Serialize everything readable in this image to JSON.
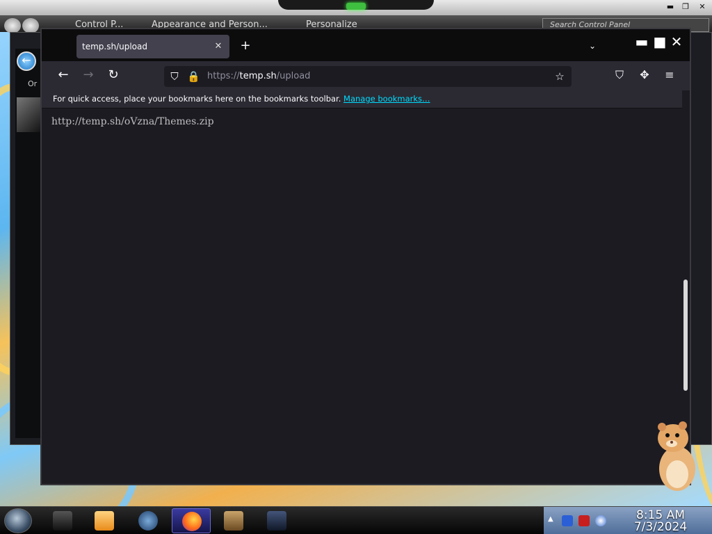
{
  "control_panel": {
    "crumbs": [
      "Control P...",
      "Appearance and Person...",
      "Personalize"
    ],
    "search_placeholder": "Search Control Panel",
    "side_label": "Or"
  },
  "browser": {
    "tab": {
      "title": "temp.sh/upload",
      "close_glyph": "✕"
    },
    "new_tab_glyph": "+",
    "tab_list_glyph": "⌄",
    "window_controls": {
      "minimize": "▬",
      "maximize": "■",
      "close": "✕"
    },
    "nav": {
      "back": "←",
      "forward": "→",
      "reload": "↻"
    },
    "url": {
      "scheme": "https://",
      "host": "temp.sh",
      "path": "/upload"
    },
    "icons": {
      "shield": "⛉",
      "lock": "🔒",
      "star": "☆",
      "pocket": "⛉",
      "extensions": "✥",
      "menu": "≡"
    },
    "bookmarks_bar": {
      "message": "For quick access, place your bookmarks here on the bookmarks toolbar. ",
      "link": "Manage bookmarks…"
    },
    "page": {
      "text": "http://temp.sh/oVzna/Themes.zip"
    }
  },
  "taskbar": {
    "clock_time": "8:15 AM",
    "clock_date": "7/3/2024",
    "active_app": "firefox"
  }
}
